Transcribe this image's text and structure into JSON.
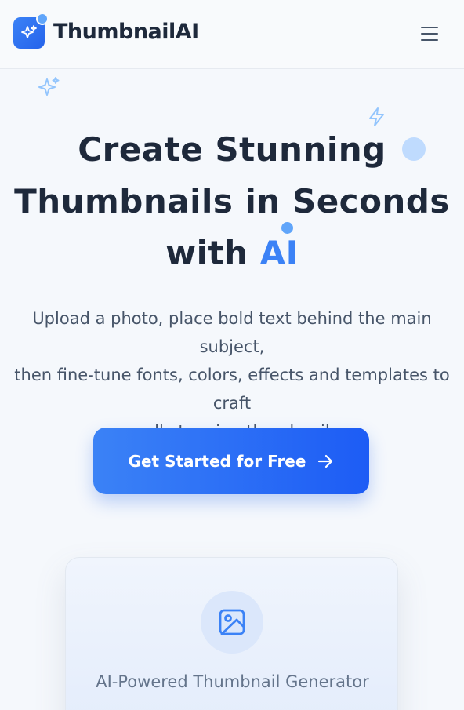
{
  "header": {
    "brand": "ThumbnailAI",
    "logo_icon": "sparkles-icon",
    "menu_icon": "hamburger-menu-icon"
  },
  "hero": {
    "title_lines": [
      "Create Stunning",
      "Thumbnails in Seconds",
      "with "
    ],
    "title_accent": "AI",
    "subtitle_lines": [
      "Upload a photo, place bold text behind the main subject,",
      "then fine-tune fonts, colors, effects and templates to craft",
      "scroll-stopping thumbnails."
    ],
    "cta_label": "Get Started for Free",
    "cta_icon": "arrow-right-icon"
  },
  "feature_card": {
    "icon": "image-icon",
    "title": "AI-Powered Thumbnail Generator"
  },
  "colors": {
    "accent": "#3b82f6",
    "text_dark": "#1e293b",
    "text_muted": "#475569",
    "background": "#f5f8fc"
  }
}
